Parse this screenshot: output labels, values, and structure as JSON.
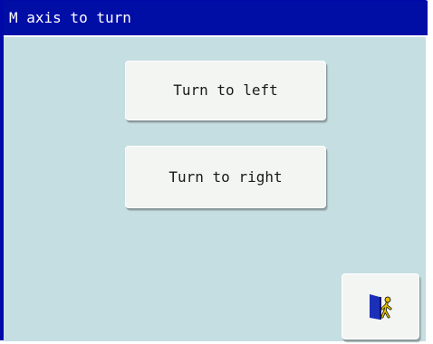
{
  "window": {
    "title": "M axis to turn"
  },
  "buttons": {
    "turn_left": "Turn to left",
    "turn_right": "Turn to right"
  },
  "exit": {
    "icon": "exit-door-icon"
  },
  "colors": {
    "title_bar": "#000ea6",
    "background": "#c4dee2",
    "button": "#f3f5f3",
    "door": "#1c2fb8",
    "figure": "#e0c000"
  }
}
